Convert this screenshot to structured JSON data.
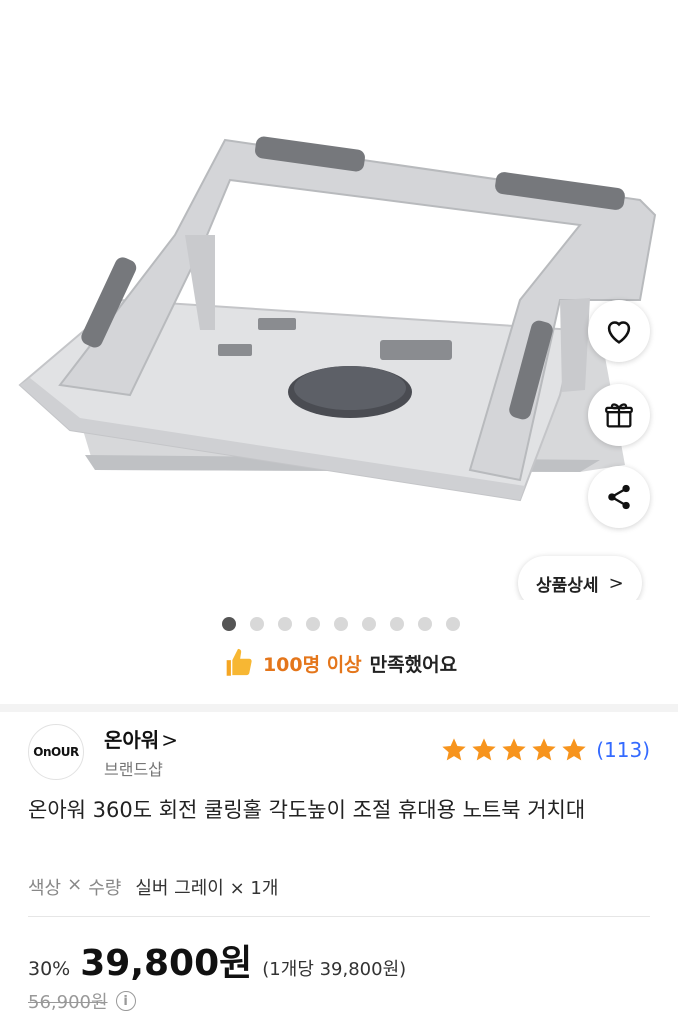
{
  "product_image": {
    "alt_icon": "laptop-stand-image"
  },
  "actions": {
    "wishlist_icon": "heart-icon",
    "gift_icon": "gift-icon",
    "share_icon": "share-icon"
  },
  "detail_button": {
    "label": "상품상세",
    "chevron": ">"
  },
  "carousel": {
    "total": 9,
    "active_index": 0
  },
  "satisfaction": {
    "highlight": "100명 이상",
    "text": "만족했어요",
    "icon": "thumbs-up-icon"
  },
  "brand": {
    "logo_text": "OnOUR",
    "name": "온아워",
    "chevron": ">",
    "subtitle": "브랜드샵"
  },
  "rating": {
    "stars": 5,
    "review_count": "(113)",
    "star_color": "#f7941d"
  },
  "product": {
    "title": "온아워 360도 회전 쿨링홀 각도높이 조절 휴대용 노트북 거치대"
  },
  "options": {
    "label_color": "색상",
    "times": "×",
    "label_qty": "수량",
    "value": "실버 그레이 × 1개"
  },
  "price": {
    "discount": "30%",
    "sale_price": "39,800원",
    "unit_price": "(1개당 39,800원)",
    "original_price": "56,900원"
  },
  "colors": {
    "accent_orange": "#e4761b",
    "review_blue": "#346aff"
  }
}
